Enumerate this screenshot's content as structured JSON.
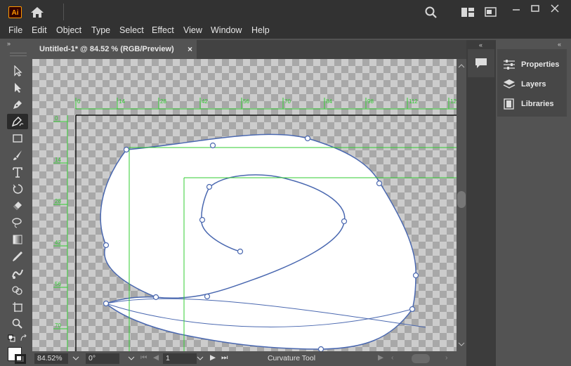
{
  "app": {
    "logo_text": "Ai",
    "window_controls": [
      "minimize",
      "maximize",
      "close"
    ]
  },
  "menu": [
    "File",
    "Edit",
    "Object",
    "Type",
    "Select",
    "Effect",
    "View",
    "Window",
    "Help"
  ],
  "document_tab": {
    "title": "Untitled-1* @ 84.52 % (RGB/Preview)",
    "close": "×"
  },
  "tools": [
    "selection-tool",
    "direct-selection-tool",
    "pen-tool",
    "curvature-tool",
    "rectangle-tool",
    "paintbrush-tool",
    "type-tool",
    "rotate-tool",
    "eraser-tool",
    "lasso-tool",
    "gradient-tool",
    "eyedropper-tool",
    "puppet-warp-tool",
    "shape-builder-tool",
    "artboard-tool",
    "zoom-tool"
  ],
  "ruler": {
    "top_ticks": [
      "0",
      "14",
      "28",
      "42",
      "56",
      "70",
      "84",
      "98",
      "112",
      "126"
    ],
    "left_ticks": [
      "0",
      "14",
      "28",
      "42",
      "56",
      "70"
    ],
    "color": "#32cd32"
  },
  "status": {
    "zoom": "84.52%",
    "rotation": "0°",
    "artboard": "1",
    "tool_name": "Curvature Tool"
  },
  "panels": {
    "properties": "Properties",
    "layers": "Layers",
    "libraries": "Libraries"
  },
  "colors": {
    "path_stroke": "#4a68b0",
    "guide": "#32cd32",
    "accent": "#ff9a00"
  }
}
